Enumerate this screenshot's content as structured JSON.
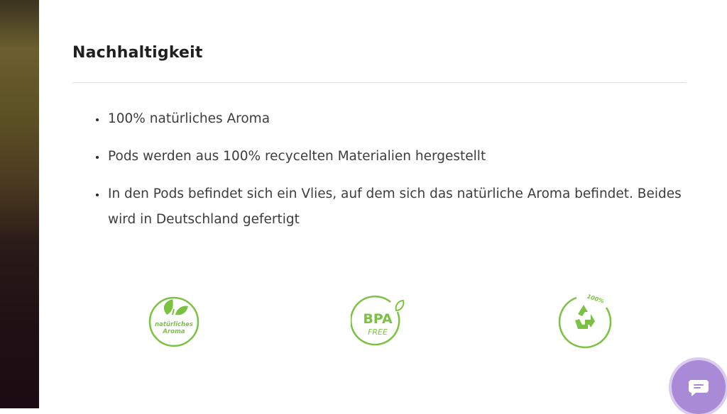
{
  "section": {
    "title": "Nachhaltigkeit",
    "items": [
      "100% natürliches Aroma",
      "Pods werden aus 100% recycelten Materialien hergestellt",
      "In den Pods befindet sich ein Vlies, auf dem sich das natürliche Aroma befindet. Beides wird in Deutschland gefertigt"
    ]
  },
  "badges": [
    {
      "icon": "leaf-icon",
      "text_line1": "natürliches",
      "text_line2": "Aroma"
    },
    {
      "icon": "bpa-free-icon",
      "text_line1": "BPA",
      "text_line2": "FREE"
    },
    {
      "icon": "recycle-icon",
      "text_top": "100%"
    }
  ],
  "chat": {
    "icon": "chat-icon"
  },
  "colors": {
    "badge_green": "#7cc242",
    "chat_purple": "#a98ad6",
    "heading": "#1f1f1f",
    "body_text": "#3d3d3d"
  }
}
